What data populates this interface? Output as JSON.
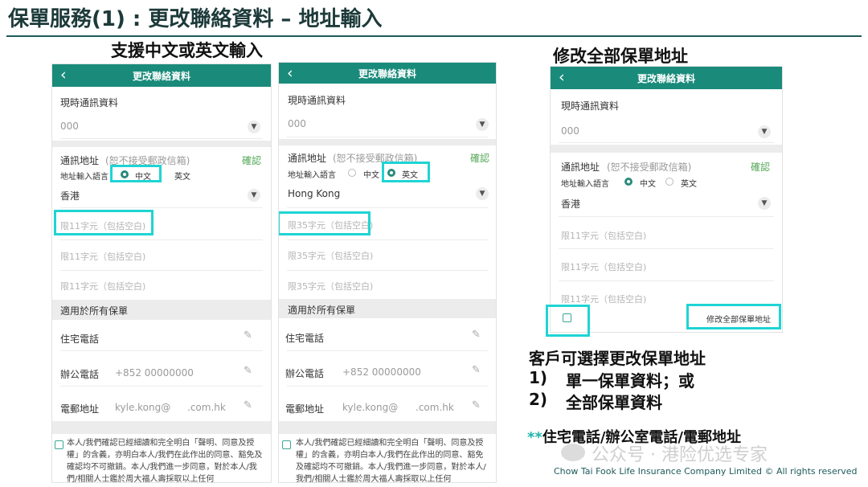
{
  "slide": {
    "title": "保單服務(1) : 更改聯絡資料 – 地址輸入",
    "caption_left": "支援中文或英文輸入",
    "caption_right": "修改全部保單地址",
    "notes": {
      "heading": "客戶可選擇更改保單地址",
      "items": [
        {
          "num": "1)",
          "text": "單一保單資料；或"
        },
        {
          "num": "2)",
          "text": "全部保單資料"
        }
      ],
      "footnote_mark": "**",
      "footnote_text": "住宅電話/辦公室電話/電郵地址"
    },
    "watermark": "公众号 · 港险优选专家",
    "copyright": "Chow Tai Fook Life Insurance Company Limited © All rights reserved"
  },
  "phone_common": {
    "header_title": "更改聯絡資料",
    "back_icon": "‹",
    "current_info_label": "現時通訊資料",
    "address_label": "通訊地址",
    "address_note": "(恕不接受郵政信箱)",
    "confirm": "確認",
    "lang_label": "地址輸入語言",
    "lang_chinese": "中文",
    "lang_english": "英文",
    "applies_all": "適用於所有保單",
    "home_phone_label": "住宅電話",
    "office_phone_label": "辦公電話",
    "office_phone_value": "+852 00000000",
    "email_label": "電郵地址",
    "email_user": "kyle.kong@",
    "email_domain": ".com.hk",
    "declaration": "本人/我們確認已經細讀和完全明白「聲明、同意及授權」的含義，亦明白本人/我們在此作出的同意、豁免及確認均不可撤銷。本人/我們進一步同意，對於本人/我們/相關人士鑑於周大福人壽採取以上任何"
  },
  "phone1": {
    "current_value": "000",
    "region": "香港",
    "placeholder": "限11字元（包括空白)",
    "selected_language": "chinese"
  },
  "phone2": {
    "current_value": "000",
    "region": "Hong Kong",
    "placeholder": "限35字元（包括空白)",
    "selected_language": "english"
  },
  "phone3": {
    "current_value": "000",
    "region": "香港",
    "placeholder": "限11字元（包括空白)",
    "selected_language": "chinese",
    "all_policies_label": "修改全部保單地址"
  },
  "colors": {
    "header": "#1a8b7b",
    "highlight": "#1fd4d4",
    "confirm": "#52a855"
  },
  "icons": {
    "back": "chevron-left-icon",
    "dropdown": "chevron-down-icon",
    "edit": "pencil-icon",
    "checkbox": "checkbox-icon"
  }
}
